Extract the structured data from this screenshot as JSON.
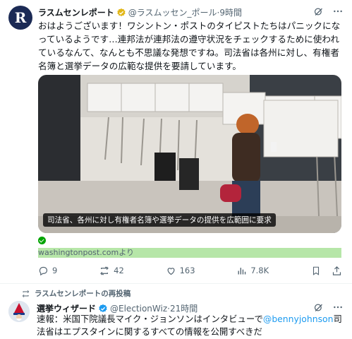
{
  "tweet1": {
    "avatar_letter": "R",
    "display_name": "ラスムセンレポート",
    "handle": "@ラスムッセン_ポール",
    "separator": "·",
    "time": "9時間",
    "text": "おはようございます！ワシントン・ポストのタイピストたちはパニックになっているようです…連邦法が連邦法の遵守状況をチェックするために使われているなんて、なんとも不思議な発想ですね。司法省は各州に対し、有権者名簿と選挙データの広範な提供を要請しています。",
    "media_caption": "司法省、各州に対し有権者名簿や選挙データの提供を広範囲に要求",
    "source": "washingtonpost.comより",
    "replies": "9",
    "reposts": "42",
    "likes": "163",
    "views": "7.8K"
  },
  "tweet2": {
    "repost_label": "ラスムセンレポートの再投稿",
    "display_name": "選挙ウィザード",
    "handle": "@ElectionWiz",
    "separator": "·",
    "time": "21時間",
    "text_before": "速報：米国下院議長マイク・ジョンソンはインタビューで",
    "mention": "@bennyjohnson",
    "text_after": "司法省はエプスタインに関するすべての情報を公開すべきだ"
  },
  "colors": {
    "accent": "#1d9bf0",
    "muted": "#536471",
    "verified_gold": "#e2b719",
    "source_highlight": "#b6e6a8"
  }
}
